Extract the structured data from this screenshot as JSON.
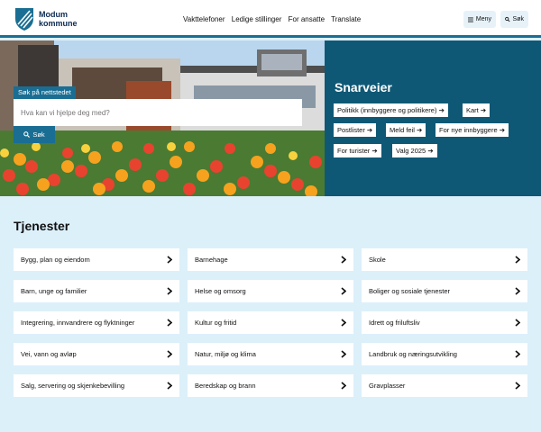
{
  "header": {
    "logo_line1": "Modum",
    "logo_line2": "kommune",
    "nav": [
      "Vakttelefoner",
      "Ledige stillinger",
      "For ansatte",
      "Translate"
    ],
    "menu_label": "Meny",
    "search_label": "Søk"
  },
  "hero": {
    "search_title": "Søk på nettstedet",
    "search_placeholder": "Hva kan vi hjelpe deg med?",
    "search_button": "Søk"
  },
  "shortcuts": {
    "title": "Snarveier",
    "items": [
      "Politikk (innbyggere og politikere)",
      "Kart",
      "Postlister",
      "Meld feil",
      "For nye innbyggere",
      "For turister",
      "Valg 2025"
    ]
  },
  "services": {
    "title": "Tjenester",
    "items": [
      "Bygg, plan og eiendom",
      "Barnehage",
      "Skole",
      "Barn, unge og familier",
      "Helse og omsorg",
      "Boliger og sosiale tjenester",
      "Integrering, innvandrere og flyktninger",
      "Kultur og fritid",
      "Idrett og friluftsliv",
      "Vei, vann og avløp",
      "Natur, miljø og klima",
      "Landbruk og næringsutvikling",
      "Salg, servering og skjenkebevilling",
      "Beredskap og brann",
      "Gravplasser"
    ]
  },
  "colors": {
    "accent": "#1a6e93",
    "shortcuts_bg": "#0f5875",
    "page_bg": "#dcf0fa"
  }
}
